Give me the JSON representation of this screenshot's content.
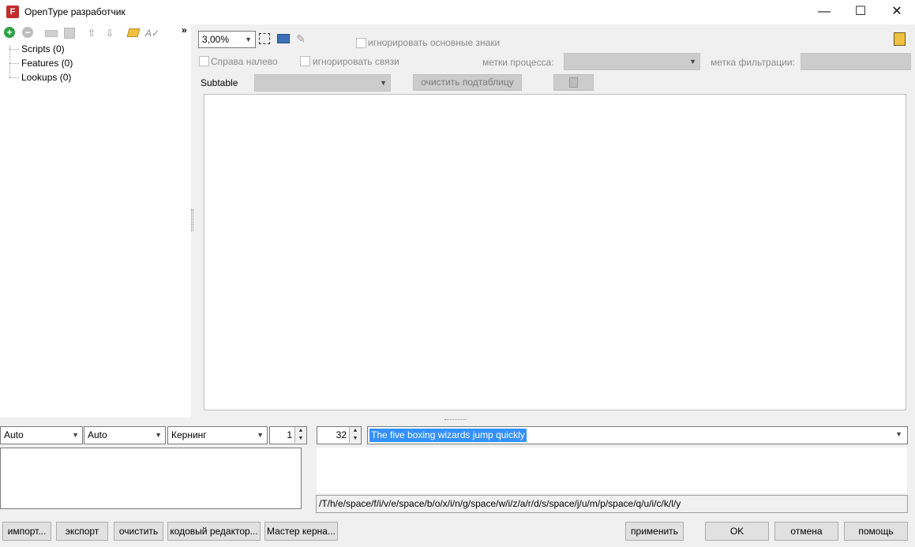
{
  "window": {
    "title": "OpenType разработчик",
    "icon": "font-app-icon",
    "minimize": "—",
    "maximize": "☐",
    "close": "✕"
  },
  "left_toolbar": {
    "add": "+",
    "remove": "−",
    "more": "»"
  },
  "tree": {
    "items": [
      {
        "label": "Scripts (0)"
      },
      {
        "label": "Features (0)"
      },
      {
        "label": "Lookups (0)"
      }
    ]
  },
  "options": {
    "zoom": "3,00%",
    "ignore_base": "игнорировать основные знаки",
    "rtl": "Справа налево",
    "ignore_ligatures": "игнорировать связи",
    "process_marks_label": "метки процесса:",
    "filter_mark_label": "метка фильтрации:",
    "subtable_label": "Subtable",
    "clear_subtable": "очистить подтаблицу"
  },
  "bottom": {
    "script_select": "Auto",
    "lang_select": "Auto",
    "feature_select": "Кернинг",
    "count": "1",
    "size": "32",
    "sample_text": "The five boxing wizards jump quickly",
    "glyph_string": "/T/h/e/space/f/i/v/e/space/b/o/x/i/n/g/space/w/i/z/a/r/d/s/space/j/u/m/p/space/q/u/i/c/k/l/y"
  },
  "buttons": {
    "import": "импорт...",
    "export": "экспорт",
    "clear": "очистить",
    "code_editor": "кодовый редактор...",
    "kern_master": "Мастер керна...",
    "apply": "применить",
    "ok": "OK",
    "cancel": "отмена",
    "help": "помощь"
  },
  "colors": {
    "accent": "#3390ff",
    "add_icon": "#2ea043",
    "app_icon": "#c42b2b"
  }
}
